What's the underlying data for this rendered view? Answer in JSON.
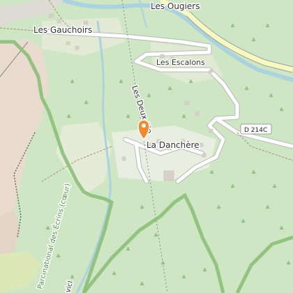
{
  "map": {
    "places": {
      "les_ougiers": "Les Ougiers",
      "les_gauchoirs": "Les Gauchoirs",
      "les_escalons": "Les Escalons",
      "la_danchere": "La Danchère",
      "les_deux_alpes": "Les Deux Alp"
    },
    "roads": {
      "d214c": "D 214C"
    },
    "areas": {
      "park": "Parc national des Écrins (cœur)",
      "edge_text": "vicl"
    },
    "marker": {
      "icon": "location-pin-icon",
      "color": "#f28b2e"
    },
    "colors": {
      "forest": "#cfe6c4",
      "rock": "#ecdfd2",
      "river": "#aad3df",
      "road": "#ffffff",
      "main_road": "#f6f9c0",
      "park_border": "#8cbf7a"
    }
  }
}
